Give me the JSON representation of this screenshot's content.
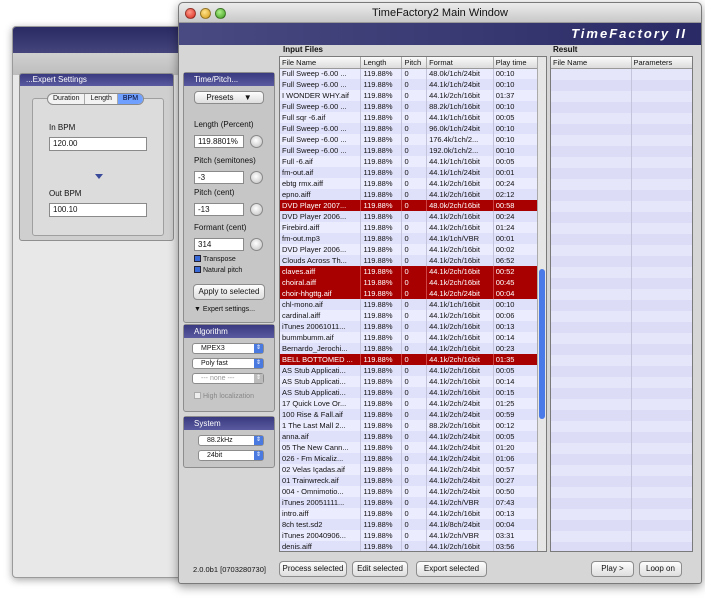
{
  "expert": {
    "title": "...Expert Settings",
    "segments": [
      "Duration",
      "Length",
      "BPM"
    ],
    "selected": "BPM",
    "in_label": "In BPM",
    "in_value": "120.00",
    "out_label": "Out BPM",
    "out_value": "100.10"
  },
  "window": {
    "title": "TimeFactory2 Main Window",
    "brand": "TimeFactory II"
  },
  "timepitch": {
    "title": "Time/Pitch...",
    "presets": "Presets",
    "length_label": "Length (Percent)",
    "length_value": "119.8801%",
    "pitch_semi_label": "Pitch (semitones)",
    "pitch_semi_value": "-3",
    "pitch_cent_label": "Pitch (cent)",
    "pitch_cent_value": "-13",
    "formant_label": "Formant (cent)",
    "formant_value": "314",
    "transpose": "Transpose",
    "natural_pitch": "Natural pitch",
    "apply": "Apply to selected",
    "expert": "Expert settings..."
  },
  "algorithm": {
    "title": "Algorithm",
    "engine": "MPEX3",
    "mode": "Poly fast",
    "option": "--- none ---",
    "high_loc": "High localization"
  },
  "system": {
    "title": "System",
    "rate": "88.2kHz",
    "bits": "24bit"
  },
  "input": {
    "label": "Input Files",
    "columns": [
      "File Name",
      "Length",
      "Pitch",
      "Format",
      "Play time"
    ],
    "rows": [
      [
        "Full Sweep -6.00 ...",
        "119.88%",
        "0",
        "48.0k/1ch/24bit",
        "00:10",
        false
      ],
      [
        "Full Sweep -6.00 ...",
        "119.88%",
        "0",
        "44.1k/1ch/24bit",
        "00:10",
        false
      ],
      [
        "I WONDER WHY.aif",
        "119.88%",
        "0",
        "44.1k/2ch/16bit",
        "01:37",
        false
      ],
      [
        "Full Sweep -6.00 ...",
        "119.88%",
        "0",
        "88.2k/1ch/16bit",
        "00:10",
        false
      ],
      [
        "Full sqr -6.aif",
        "119.88%",
        "0",
        "44.1k/1ch/16bit",
        "00:05",
        false
      ],
      [
        "Full Sweep -6.00 ...",
        "119.88%",
        "0",
        "96.0k/1ch/24bit",
        "00:10",
        false
      ],
      [
        "Full Sweep -6.00 ...",
        "119.88%",
        "0",
        "176.4k/1ch/2...",
        "00:10",
        false
      ],
      [
        "Full Sweep -6.00 ...",
        "119.88%",
        "0",
        "192.0k/1ch/2...",
        "00:10",
        false
      ],
      [
        "Full -6.aif",
        "119.88%",
        "0",
        "44.1k/1ch/16bit",
        "00:05",
        false
      ],
      [
        "fm-out.aif",
        "119.88%",
        "0",
        "44.1k/1ch/24bit",
        "00:01",
        false
      ],
      [
        "ebtg rmx.aiff",
        "119.88%",
        "0",
        "44.1k/2ch/16bit",
        "00:24",
        false
      ],
      [
        "epno.aiff",
        "119.88%",
        "0",
        "44.1k/2ch/16bit",
        "02:12",
        false
      ],
      [
        "DVD Player 2007...",
        "119.88%",
        "0",
        "48.0k/2ch/16bit",
        "00:58",
        true
      ],
      [
        "DVD Player 2006...",
        "119.88%",
        "0",
        "44.1k/2ch/16bit",
        "00:24",
        false
      ],
      [
        "Firebird.aiff",
        "119.88%",
        "0",
        "44.1k/2ch/16bit",
        "01:24",
        false
      ],
      [
        "fm-out.mp3",
        "119.88%",
        "0",
        "44.1k/1ch/VBR",
        "00:01",
        false
      ],
      [
        "DVD Player 2006...",
        "119.88%",
        "0",
        "44.1k/2ch/16bit",
        "00:02",
        false
      ],
      [
        "Clouds Across Th...",
        "119.88%",
        "0",
        "44.1k/2ch/16bit",
        "06:52",
        false
      ],
      [
        "claves.aiff",
        "119.88%",
        "0",
        "44.1k/2ch/16bit",
        "00:52",
        true
      ],
      [
        "choiral.aiff",
        "119.88%",
        "0",
        "44.1k/2ch/16bit",
        "00:45",
        true
      ],
      [
        "choir-hhgttg.aif",
        "119.88%",
        "0",
        "44.1k/2ch/24bit",
        "00:04",
        true
      ],
      [
        "chl-mono.aif",
        "119.88%",
        "0",
        "44.1k/1ch/16bit",
        "00:10",
        false
      ],
      [
        "cardinal.aiff",
        "119.88%",
        "0",
        "44.1k/2ch/16bit",
        "00:06",
        false
      ],
      [
        "iTunes 20061011...",
        "119.88%",
        "0",
        "44.1k/2ch/16bit",
        "00:13",
        false
      ],
      [
        "bummbumm.aif",
        "119.88%",
        "0",
        "44.1k/2ch/16bit",
        "00:14",
        false
      ],
      [
        "Bernardo_Jerochi...",
        "119.88%",
        "0",
        "44.1k/2ch/16bit",
        "00:23",
        false
      ],
      [
        "BELL BOTTOMED ...",
        "119.88%",
        "0",
        "44.1k/2ch/16bit",
        "01:35",
        true
      ],
      [
        "AS Stub Applicati...",
        "119.88%",
        "0",
        "44.1k/2ch/16bit",
        "00:05",
        false
      ],
      [
        "AS Stub Applicati...",
        "119.88%",
        "0",
        "44.1k/2ch/16bit",
        "00:14",
        false
      ],
      [
        "AS Stub Applicati...",
        "119.88%",
        "0",
        "44.1k/2ch/16bit",
        "00:15",
        false
      ],
      [
        "17 Quick Love Or...",
        "119.88%",
        "0",
        "44.1k/2ch/24bit",
        "01:25",
        false
      ],
      [
        "100 Rise & Fall.aif",
        "119.88%",
        "0",
        "44.1k/2ch/24bit",
        "00:59",
        false
      ],
      [
        "1 The Last Mall 2...",
        "119.88%",
        "0",
        "88.2k/2ch/16bit",
        "00:12",
        false
      ],
      [
        "anna.aif",
        "119.88%",
        "0",
        "44.1k/2ch/24bit",
        "00:05",
        false
      ],
      [
        "05 The New Cann...",
        "119.88%",
        "0",
        "44.1k/2ch/24bit",
        "01:20",
        false
      ],
      [
        "026 - Fm Micaliz...",
        "119.88%",
        "0",
        "44.1k/2ch/24bit",
        "01:06",
        false
      ],
      [
        "02 Velas Içadas.aif",
        "119.88%",
        "0",
        "44.1k/2ch/24bit",
        "00:57",
        false
      ],
      [
        "01 Trainwreck.aif",
        "119.88%",
        "0",
        "44.1k/2ch/24bit",
        "00:27",
        false
      ],
      [
        "004 - Omnimotio...",
        "119.88%",
        "0",
        "44.1k/2ch/24bit",
        "00:50",
        false
      ],
      [
        "iTunes 20051111...",
        "119.88%",
        "0",
        "44.1k/2ch/VBR",
        "07:43",
        false
      ],
      [
        "intro.aiff",
        "119.88%",
        "0",
        "44.1k/2ch/16bit",
        "00:13",
        false
      ],
      [
        "8ch test.sd2",
        "119.88%",
        "0",
        "44.1k/8ch/24bit",
        "00:04",
        false
      ],
      [
        "iTunes 20040906...",
        "119.88%",
        "0",
        "44.1k/2ch/VBR",
        "03:31",
        false
      ],
      [
        "denis.aiff",
        "119.88%",
        "0",
        "44.1k/2ch/16bit",
        "03:56",
        false
      ]
    ]
  },
  "result": {
    "label": "Result",
    "columns": [
      "File Name",
      "Parameters"
    ]
  },
  "footer": {
    "version": "2.0.0b1 [0703280730]",
    "process": "Process selected",
    "edit": "Edit selected",
    "export": "Export selected",
    "play": "Play >",
    "loop": "Loop on"
  },
  "colors": {
    "highlight": "#a80000",
    "banner": "#3a3a78",
    "row": "#ececff"
  }
}
